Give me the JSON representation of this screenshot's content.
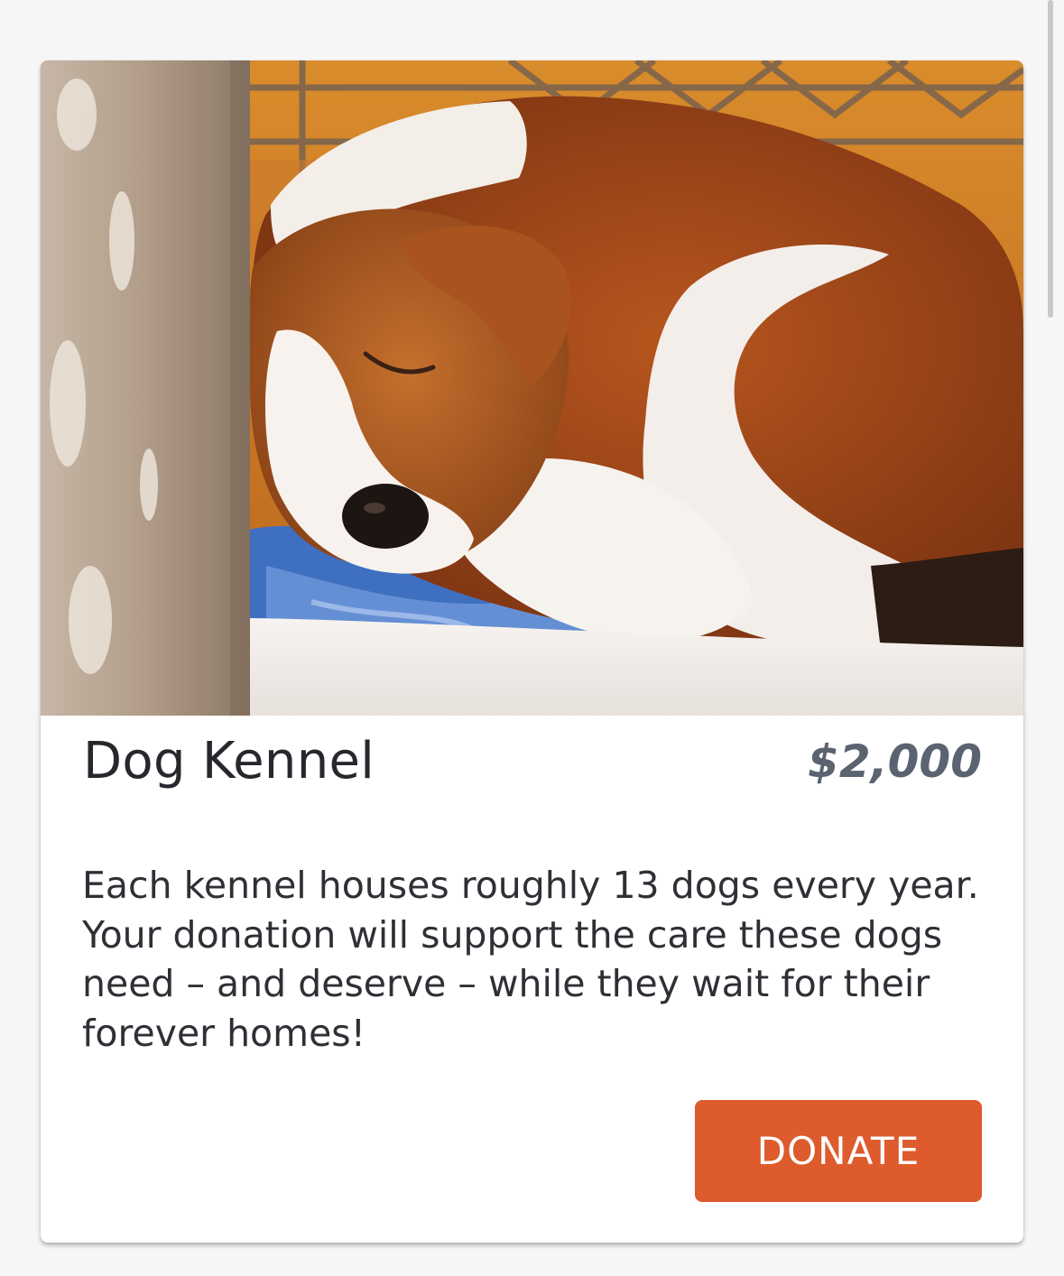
{
  "product": {
    "title": "Dog Kennel",
    "price": "$2,000",
    "description": "Each kennel houses roughly 13 dogs every year. Your donation will support the care these dogs need – and deserve – while they wait for their forever homes!",
    "photo_alt": "photo-of-sleeping-dog"
  },
  "actions": {
    "donate_label": "DONATE"
  },
  "colors": {
    "page_background": "#f6f6f7",
    "card_background": "#ffffff",
    "title_text": "#26282e",
    "price_text": "#5b6371",
    "body_text": "#2e3036",
    "donate_button": "#dd5b2c",
    "donate_text": "#ffffff"
  }
}
